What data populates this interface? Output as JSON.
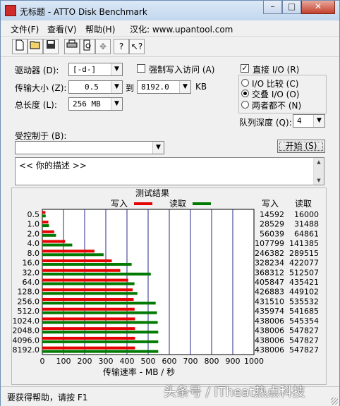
{
  "window": {
    "title": "无标题 - ATTO Disk Benchmark"
  },
  "menu": [
    "文件(F)",
    "查看(V)",
    "帮助(H)",
    "汉化: www.upantool.com"
  ],
  "toolbar_icons": [
    "new-file-icon",
    "open-folder-icon",
    "save-icon",
    "print-icon",
    "print-preview-icon",
    "move-icon",
    "help-icon",
    "context-help-icon"
  ],
  "settings": {
    "drive_label": "驱动器 (D):",
    "drive_value": "[-d-]",
    "transfer_label": "传输大小 (Z):",
    "transfer_from": "0.5",
    "transfer_to_label": "到",
    "transfer_to": "8192.0",
    "transfer_unit": "KB",
    "total_length_label": "总长度 (L):",
    "total_length": "256 MB",
    "force_write_label": "强制写入访问 (A)",
    "force_write_checked": false,
    "direct_io_label": "直接 I/O (R)",
    "direct_io_checked": true,
    "io_compare_label": "I/O 比较 (C)",
    "overlapped_io_label": "交叠 I/O (O)",
    "neither_label": "两者都不 (N)",
    "selected_mode": "overlapped",
    "queue_depth_label": "队列深度 (Q):",
    "queue_depth": "4",
    "controlled_by_label": "受控制于 (B):",
    "controlled_by": "",
    "start_button": "开始 (S)",
    "description": "<<   你的描述    >>"
  },
  "results_title": "测试结果",
  "legend": {
    "write": "写入",
    "read": "读取"
  },
  "columns": {
    "write": "写入",
    "read": "读取"
  },
  "colors": {
    "write": "#e60000",
    "read": "#007a00",
    "grid": "#2a2a8a"
  },
  "chart_data": {
    "type": "bar",
    "orientation": "horizontal",
    "title": "测试结果",
    "xlabel": "传输速率 - MB / 秒",
    "xlim": [
      0,
      1000
    ],
    "xticks": [
      0,
      100,
      200,
      300,
      400,
      500,
      600,
      700,
      800,
      900,
      1000
    ],
    "categories": [
      "0.5",
      "1.0",
      "2.0",
      "4.0",
      "8.0",
      "16.0",
      "32.0",
      "64.0",
      "128.0",
      "256.0",
      "512.0",
      "1024.0",
      "2048.0",
      "4096.0",
      "8192.0"
    ],
    "series": [
      {
        "name": "写入",
        "values": [
          14592,
          28529,
          56039,
          107799,
          246382,
          328234,
          368312,
          405847,
          426883,
          431510,
          435974,
          438006,
          438006,
          438006,
          438006
        ]
      },
      {
        "name": "读取",
        "values": [
          16000,
          31488,
          64861,
          141385,
          289515,
          422077,
          512507,
          435421,
          449102,
          535532,
          541685,
          545354,
          547827,
          547827,
          547827
        ]
      }
    ]
  },
  "status": {
    "text": "要获得帮助，请按 F1"
  },
  "watermark": "头条号 / ITheat热点科技"
}
